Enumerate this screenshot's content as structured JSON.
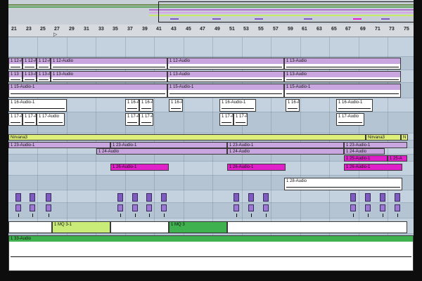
{
  "ruler": {
    "bars": [
      "21",
      "23",
      "25",
      "27",
      "29",
      "31",
      "33",
      "35",
      "37",
      "39",
      "41",
      "43",
      "45",
      "47",
      "49",
      "51",
      "53",
      "55",
      "57",
      "59",
      "61",
      "63",
      "65",
      "67",
      "69",
      "71",
      "73",
      "75"
    ],
    "marker": "▷"
  },
  "clips": {
    "t12a": "1 12-A",
    "t12b": "1 12-Au",
    "t12c": "1 12-Au",
    "t12d": "1 12-Audio",
    "t12e": "1 12-Audio",
    "t13main": "1 13-Audio",
    "t13a": "1 13",
    "t13b": "1 13-Au",
    "t13c": "1 13-Au",
    "t13d": "1 13-Audio",
    "t13e": "1 13-Audio",
    "t13f": "1 13-Audio",
    "t15a": "1 15-Audio-1",
    "t15b": "1 15-Audio-1",
    "t15c": "1 15-Audio-1",
    "t16a": "1 16-Audio-1",
    "t16b": "1 16-A",
    "t16c": "1 16-A",
    "t16d": "1 16-A",
    "t16e": "1 16-Audio-1",
    "t16f": "1 16-A",
    "t16g": "1 16-Audio-1",
    "t17a": "1 17-A",
    "t17b": "1 17-A",
    "t17c": "1 17-Audio",
    "t17d": "1 17-A",
    "t17e": "1 17-A",
    "t17f": "1 17-A",
    "t17g": "1 17-A",
    "t17h": "1 17-Audio",
    "nirvana1": "Nirvana3",
    "nirvana2": "Nirvana3",
    "nirvana3": "N",
    "t23a": "1 23-Audio-1",
    "t23b": "1 23-Audio-1",
    "t23c": "1 23-Audio-1",
    "t23d": "1 23-Audio-1",
    "t24a": "1 24-Audio",
    "t24b": "1 24-Audio",
    "t24c": "1 24-Audio",
    "t25a": "1 25-Audio-1",
    "t25b": "1 25-A",
    "t26a": "1 26-Audio-1",
    "t26b": "1 26-Audio-1",
    "t26c": "1 26-Audio-1",
    "t28a": "1 28-Audio",
    "mq1": "1 MQ 3-1",
    "mq2": "1 MQ 3",
    "t33": "1 33-Audio"
  }
}
